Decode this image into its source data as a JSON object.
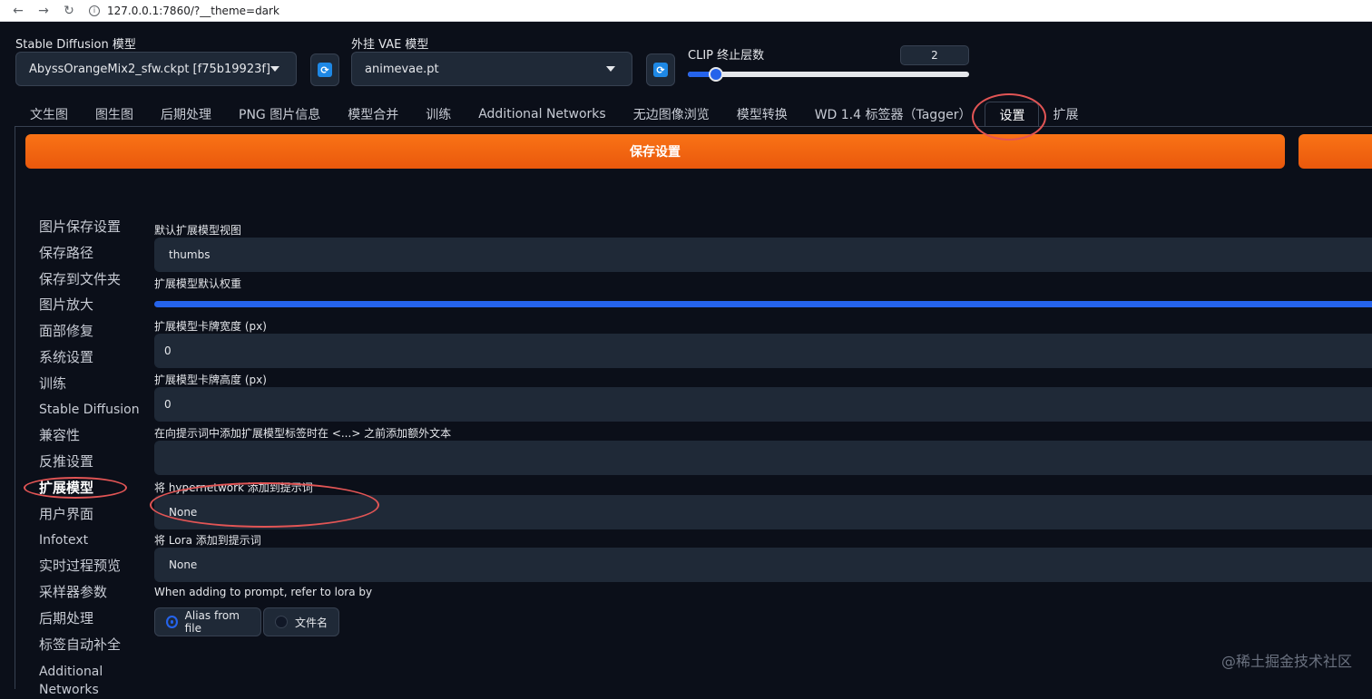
{
  "browser": {
    "back_icon": "←",
    "forward_icon": "→",
    "reload_icon": "↻",
    "url": "127.0.0.1:7860/?__theme=dark"
  },
  "top": {
    "sd_model_label": "Stable Diffusion 模型",
    "sd_model_value": "AbyssOrangeMix2_sfw.ckpt [f75b19923f]",
    "vae_label": "外挂 VAE 模型",
    "vae_value": "animevae.pt",
    "clip_label": "CLIP 终止层数",
    "clip_value": "2",
    "clip_fraction": 0.1
  },
  "tabs": [
    {
      "label": "文生图"
    },
    {
      "label": "图生图"
    },
    {
      "label": "后期处理"
    },
    {
      "label": "PNG 图片信息"
    },
    {
      "label": "模型合并"
    },
    {
      "label": "训练"
    },
    {
      "label": "Additional Networks"
    },
    {
      "label": "无边图像浏览"
    },
    {
      "label": "模型转换"
    },
    {
      "label": "WD 1.4 标签器（Tagger）"
    },
    {
      "label": "设置"
    },
    {
      "label": "扩展"
    }
  ],
  "save_button": "保存设置",
  "sidebar": {
    "items": [
      {
        "label": "图片保存设置"
      },
      {
        "label": "保存路径"
      },
      {
        "label": "保存到文件夹"
      },
      {
        "label": "图片放大"
      },
      {
        "label": "面部修复"
      },
      {
        "label": "系统设置"
      },
      {
        "label": "训练"
      },
      {
        "label": "Stable Diffusion"
      },
      {
        "label": "兼容性"
      },
      {
        "label": "反推设置"
      },
      {
        "label": "扩展模型"
      },
      {
        "label": "用户界面"
      },
      {
        "label": "Infotext"
      },
      {
        "label": "实时过程预览"
      },
      {
        "label": "采样器参数"
      },
      {
        "label": "后期处理"
      },
      {
        "label": "标签自动补全"
      },
      {
        "label": "Additional"
      },
      {
        "label": "Networks"
      }
    ]
  },
  "settings": {
    "default_view_label": "默认扩展模型视图",
    "default_view_value": "thumbs",
    "default_weight_label": "扩展模型默认权重",
    "card_width_label": "扩展模型卡牌宽度 (px)",
    "card_width_value": "0",
    "card_height_label": "扩展模型卡牌高度 (px)",
    "card_height_value": "0",
    "extra_text_label": "在向提示词中添加扩展模型标签时在 <...> 之前添加额外文本",
    "extra_text_value": "",
    "hypernetwork_label": "将 hypernetwork 添加到提示词",
    "hypernetwork_value": "None",
    "lora_label": "将 Lora 添加到提示词",
    "lora_value": "None",
    "refer_label": "When adding to prompt, refer to lora by",
    "refer_option_alias": "Alias from file",
    "refer_option_filename": "文件名"
  },
  "watermark": "@稀土掘金技术社区",
  "colors": {
    "background": "#0b0f19",
    "accent_orange": "#f97316",
    "accent_blue": "#2563eb",
    "annotation_red": "#e25555"
  }
}
